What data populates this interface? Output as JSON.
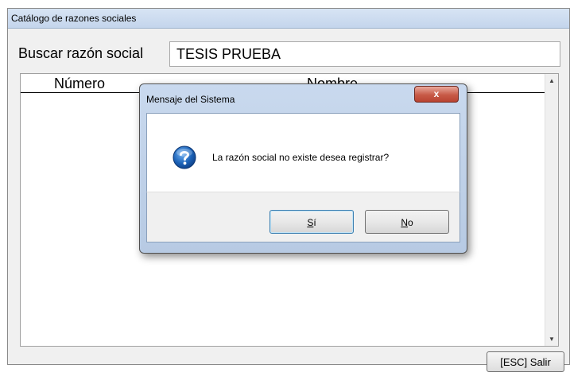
{
  "window": {
    "title": "Catálogo de razones sociales"
  },
  "search": {
    "label": "Buscar razón social",
    "value": "TESIS PRUEBA"
  },
  "grid": {
    "columns": [
      "Número",
      "Nombre"
    ],
    "rows": []
  },
  "footer": {
    "exit_label": "[ESC] Salir"
  },
  "dialog": {
    "title": "Mensaje del Sistema",
    "message": "La razón social no existe desea registrar?",
    "close_label": "x",
    "yes_mnemonic": "S",
    "yes_rest": "í",
    "no_mnemonic": "N",
    "no_rest": "o",
    "icon": "question-icon"
  },
  "colors": {
    "titlebar": "#c8d8ee",
    "dialog_frame": "#b7cae3",
    "close_button": "#c75a47",
    "question_icon": "#1c63b8"
  }
}
